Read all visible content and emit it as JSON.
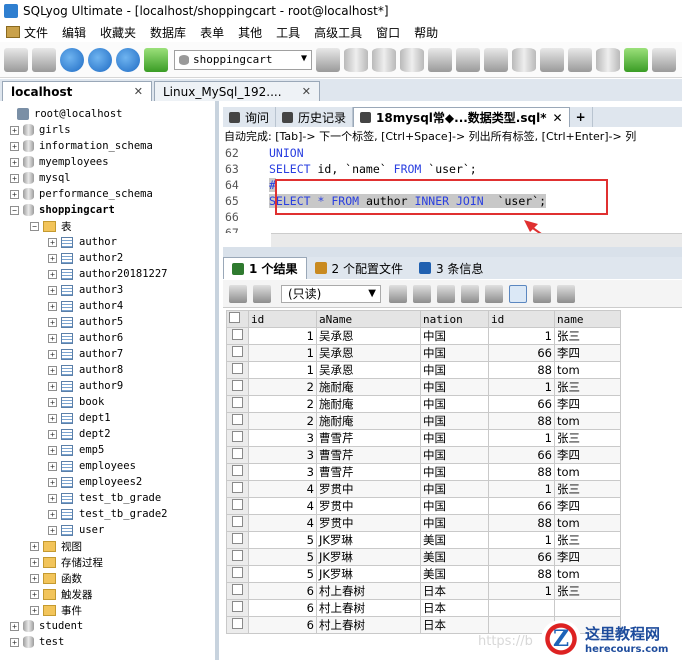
{
  "window": {
    "title": "SQLyog Ultimate - [localhost/shoppingcart - root@localhost*]"
  },
  "menu": [
    "文件",
    "编辑",
    "收藏夹",
    "数据库",
    "表单",
    "其他",
    "工具",
    "高级工具",
    "窗口",
    "帮助"
  ],
  "toolbar": {
    "database_select": "shoppingcart"
  },
  "connection_tabs": [
    {
      "label": "localhost",
      "active": true
    },
    {
      "label": "Linux_MySql_192....",
      "active": false
    }
  ],
  "tree": {
    "root": "root@localhost",
    "databases_before": [
      "girls",
      "information_schema",
      "myemployees",
      "mysql",
      "performance_schema"
    ],
    "open_db": "shoppingcart",
    "tables_folder": "表",
    "tables": [
      "author",
      "author2",
      "author20181227",
      "author3",
      "author4",
      "author5",
      "author6",
      "author7",
      "author8",
      "author9",
      "book",
      "dept1",
      "dept2",
      "emp5",
      "employees",
      "employees2",
      "test_tb_grade",
      "test_tb_grade2",
      "user"
    ],
    "subfolders": [
      "视图",
      "存储过程",
      "函数",
      "触发器",
      "事件"
    ],
    "databases_after": [
      "student",
      "test"
    ]
  },
  "query_tabs": [
    {
      "label": "询问",
      "active": false
    },
    {
      "label": "历史记录",
      "active": false
    },
    {
      "label": "18mysql常◆...数据类型.sql*",
      "active": true
    }
  ],
  "autocomplete_hint": "自动完成: [Tab]-> 下一个标签, [Ctrl+Space]-> 列出所有标签, [Ctrl+Enter]-> 列",
  "editor_lines": [
    {
      "n": "62",
      "tokens": [
        [
          "kw",
          "UNION"
        ]
      ]
    },
    {
      "n": "63",
      "tokens": [
        [
          "kw",
          "SELECT"
        ],
        [
          "str",
          " id, `name` "
        ],
        [
          "kw",
          "FROM"
        ],
        [
          "str",
          " `user`;"
        ]
      ]
    },
    {
      "n": "64",
      "tokens": [
        [
          "kw",
          "#"
        ]
      ]
    },
    {
      "n": "65",
      "tokens": [
        [
          "kw",
          "SELECT"
        ],
        [
          "str",
          " "
        ],
        [
          "kw",
          "*"
        ],
        [
          "str",
          " "
        ],
        [
          "kw",
          "FROM"
        ],
        [
          "str",
          " author "
        ],
        [
          "kw",
          "INNER JOIN"
        ],
        [
          "str",
          "  `user`;"
        ]
      ]
    },
    {
      "n": "66",
      "tokens": []
    },
    {
      "n": "67",
      "tokens": []
    }
  ],
  "result_tabs": [
    {
      "label": "1 个结果",
      "active": true
    },
    {
      "label": "2 个配置文件",
      "active": false
    },
    {
      "label": "3 条信息",
      "active": false
    }
  ],
  "result_toolbar": {
    "mode_select": "(只读)"
  },
  "results": {
    "columns": [
      "id",
      "aName",
      "nation",
      "id",
      "name"
    ],
    "rows": [
      [
        "1",
        "吴承恩",
        "中国",
        "1",
        "张三"
      ],
      [
        "1",
        "吴承恩",
        "中国",
        "66",
        "李四"
      ],
      [
        "1",
        "吴承恩",
        "中国",
        "88",
        "tom"
      ],
      [
        "2",
        "施耐庵",
        "中国",
        "1",
        "张三"
      ],
      [
        "2",
        "施耐庵",
        "中国",
        "66",
        "李四"
      ],
      [
        "2",
        "施耐庵",
        "中国",
        "88",
        "tom"
      ],
      [
        "3",
        "曹雪芹",
        "中国",
        "1",
        "张三"
      ],
      [
        "3",
        "曹雪芹",
        "中国",
        "66",
        "李四"
      ],
      [
        "3",
        "曹雪芹",
        "中国",
        "88",
        "tom"
      ],
      [
        "4",
        "罗贯中",
        "中国",
        "1",
        "张三"
      ],
      [
        "4",
        "罗贯中",
        "中国",
        "66",
        "李四"
      ],
      [
        "4",
        "罗贯中",
        "中国",
        "88",
        "tom"
      ],
      [
        "5",
        "JK罗琳",
        "美国",
        "1",
        "张三"
      ],
      [
        "5",
        "JK罗琳",
        "美国",
        "66",
        "李四"
      ],
      [
        "5",
        "JK罗琳",
        "美国",
        "88",
        "tom"
      ],
      [
        "6",
        "村上春树",
        "日本",
        "1",
        "张三"
      ],
      [
        "6",
        "村上春树",
        "日本",
        "",
        ""
      ],
      [
        "6",
        "村上春树",
        "日本",
        "",
        ""
      ]
    ]
  },
  "watermark": {
    "title": "这里教程网",
    "url": "herecours.com"
  },
  "faint_text": "https://b"
}
